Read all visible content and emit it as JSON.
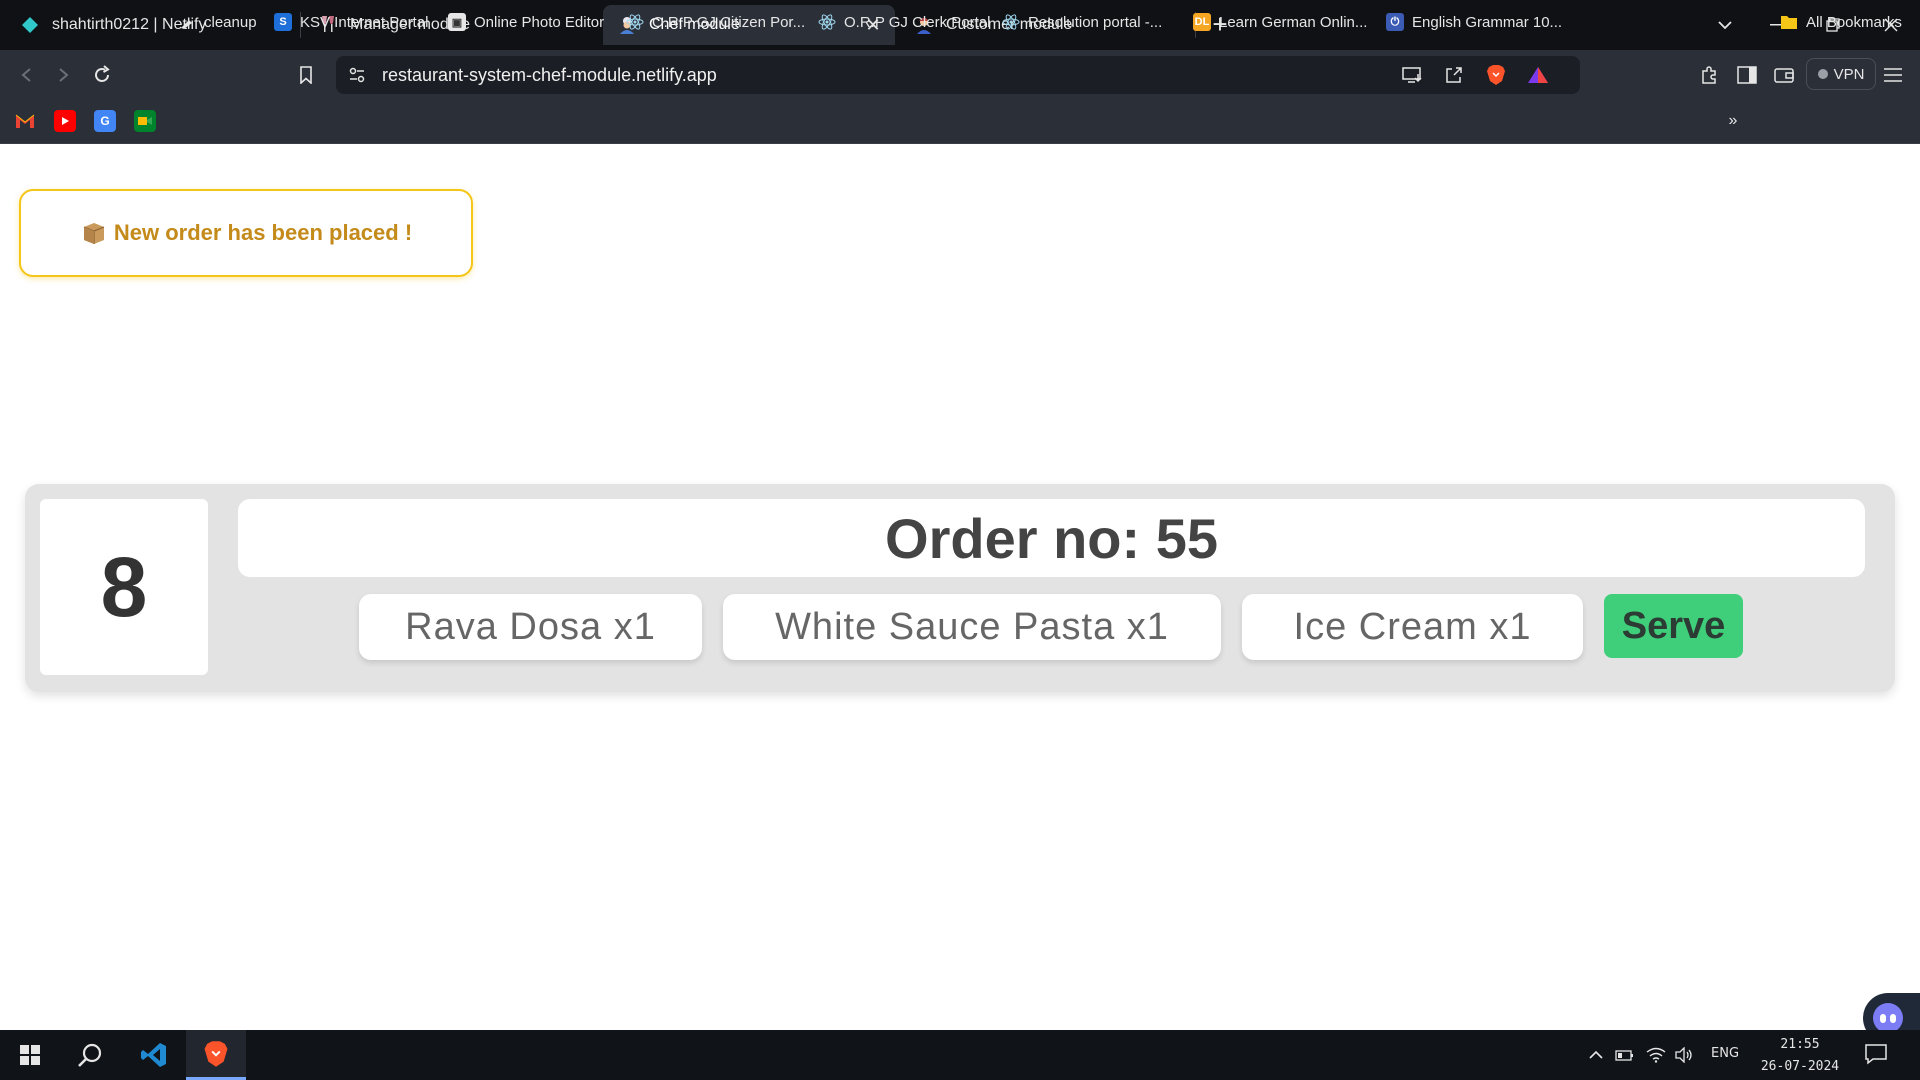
{
  "browser": {
    "tabs": [
      {
        "title": "shahtirth0212 | Netlify"
      },
      {
        "title": "Manager module"
      },
      {
        "title": "Chef module"
      },
      {
        "title": "Customer module"
      }
    ],
    "url": "restaurant-system-chef-module.netlify.app",
    "vpn_label": "VPN",
    "bookmarks": [
      {
        "label": "cleanup"
      },
      {
        "label": "KSV Internet Portal"
      },
      {
        "label": "Online Photo Editor"
      },
      {
        "label": "O.R.P GJ Citizen Por..."
      },
      {
        "label": "O.R.P GJ Clerk Portal"
      },
      {
        "label": "Resolution portal -..."
      },
      {
        "label": "Learn German Onlin..."
      },
      {
        "label": "English Grammar 10..."
      },
      {
        "label": "All Bookmarks"
      }
    ]
  },
  "notification": {
    "text": "New order has been placed !"
  },
  "order": {
    "table_number": "8",
    "title": "Order no: 55",
    "items": [
      {
        "label": "Rava Dosa x1"
      },
      {
        "label": "White Sauce Pasta x1"
      },
      {
        "label": "Ice Cream x1"
      }
    ],
    "serve_label": "Serve"
  },
  "taskbar": {
    "language": "ENG",
    "time": "21:55",
    "date": "26-07-2024"
  },
  "colors": {
    "toast_border": "#f5c518",
    "toast_text": "#c48a1a",
    "serve_bg": "#3fcf7a",
    "card_bg": "#e3e3e3"
  }
}
